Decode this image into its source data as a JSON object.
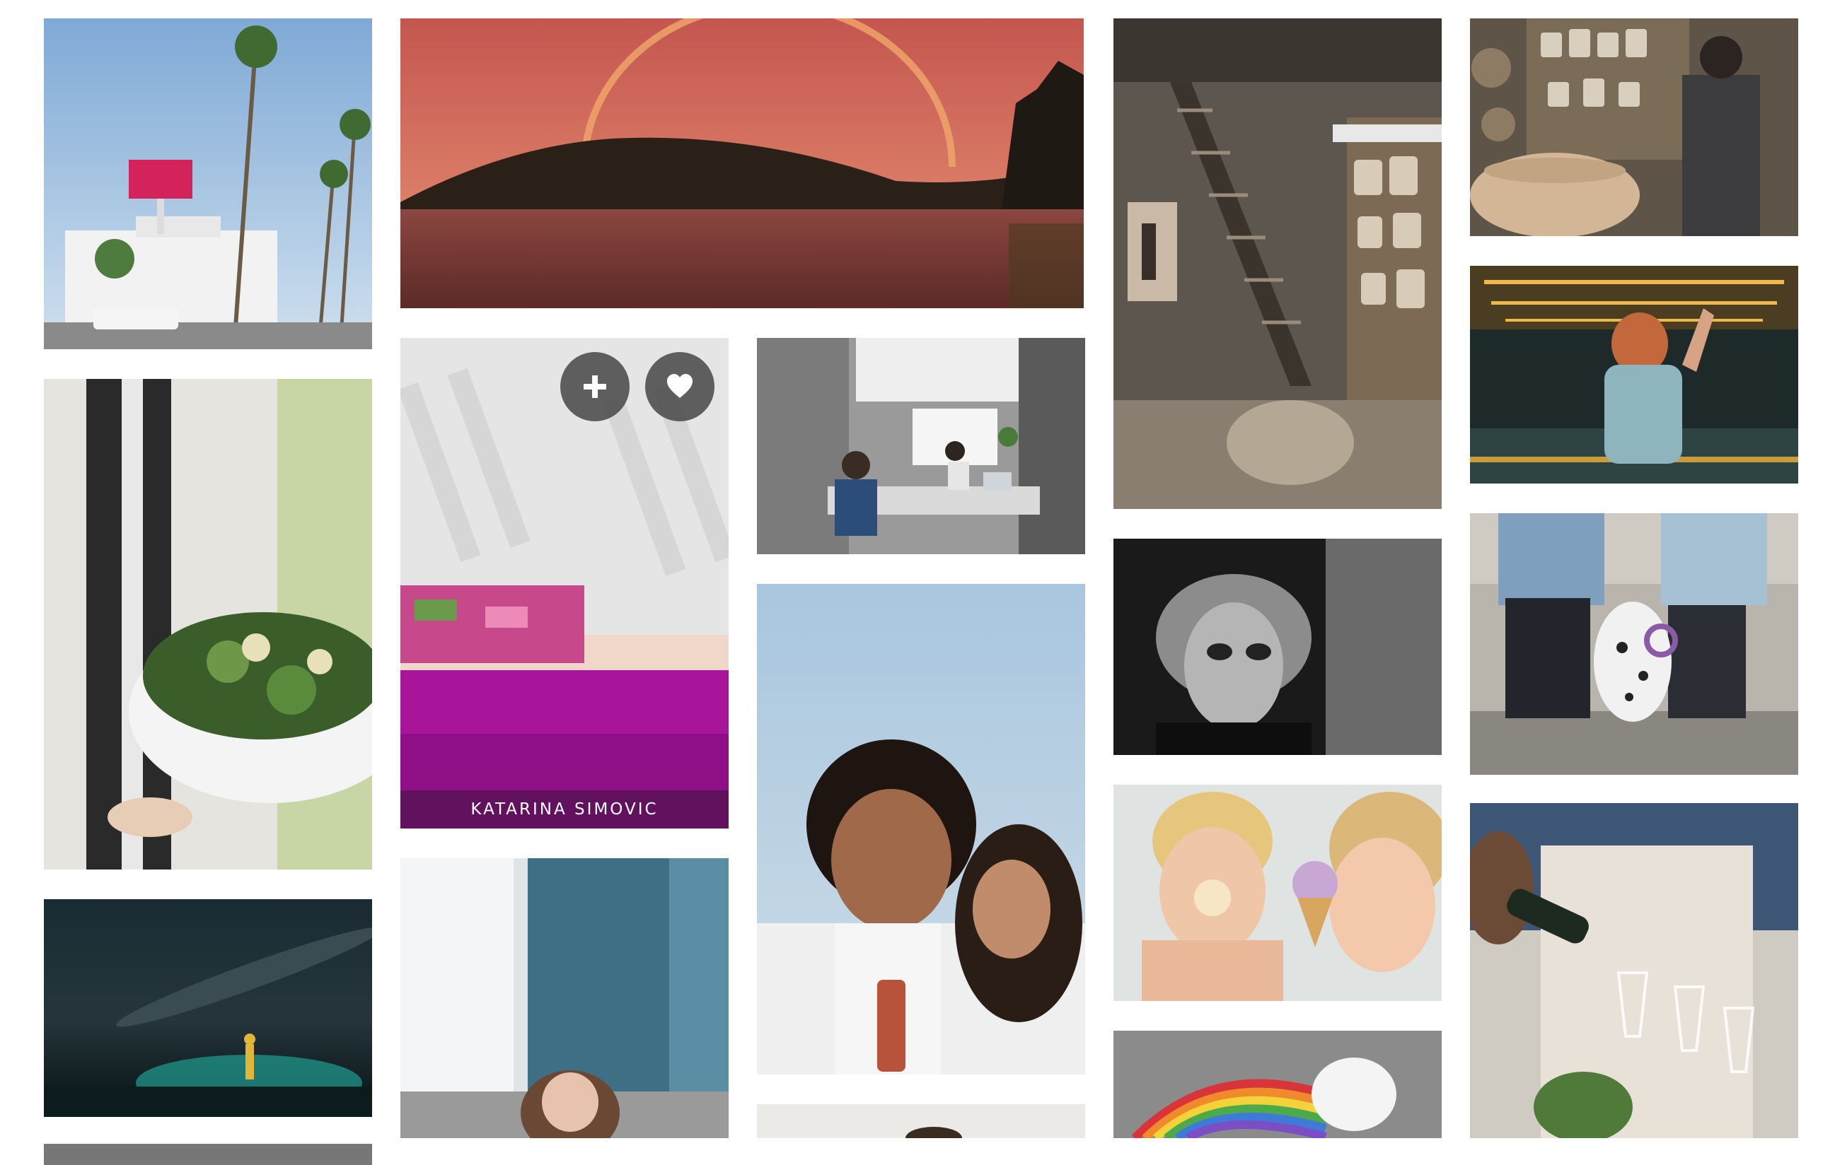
{
  "gallery": {
    "tiles": [
      {
        "subject": "palm-trees-billboard-street"
      },
      {
        "subject": "sunset-rainbow-lake"
      },
      {
        "subject": "pottery-workshop-stairs"
      },
      {
        "subject": "potter-at-wheel"
      },
      {
        "subject": "woman-holding-salad-bowl"
      },
      {
        "subject": "sunlit-bed-floral-dress"
      },
      {
        "subject": "office-people-laptops"
      },
      {
        "subject": "dancer-roller-rink"
      },
      {
        "subject": "black-and-white-portrait"
      },
      {
        "subject": "couple-with-dalmatian"
      },
      {
        "subject": "couple-laughing"
      },
      {
        "subject": "kids-eating-ice-cream"
      },
      {
        "subject": "night-sky-person-with-light"
      },
      {
        "subject": "pouring-champagne"
      },
      {
        "subject": "woman-by-window"
      },
      {
        "subject": "chalk-rainbow-drawing"
      }
    ],
    "hovered_tile": {
      "author": "KATARINA SIMOVIC",
      "add_icon": "plus-icon",
      "like_icon": "heart-icon"
    }
  },
  "colors": {
    "background": "#ffffff",
    "overlay_button": "#464646",
    "author_text": "#ffffff"
  }
}
